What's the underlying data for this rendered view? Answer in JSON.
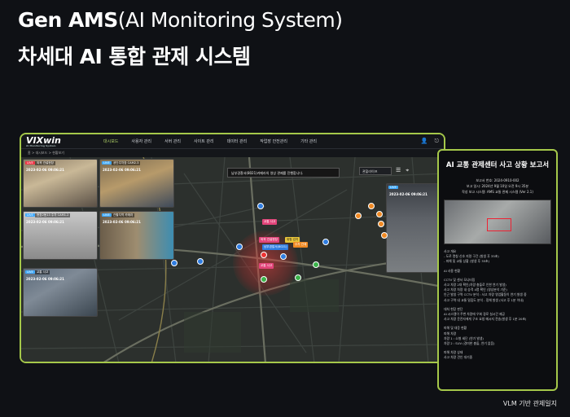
{
  "hero": {
    "title_bold": "Gen AMS",
    "title_thin": "(AI Monitoring System)",
    "subtitle": "차세대 AI 통합 관제 시스템"
  },
  "app": {
    "logo": "VIXwin",
    "logo_sub": "AI Monitoring System",
    "nav": [
      "대시보드",
      "사용자 관리",
      "서버 관리",
      "사이트 관리",
      "데이터 관리",
      "작업장 안전관리",
      "기타 관리"
    ],
    "nav_active_index": 0,
    "breadcrumb": "홈 > 대시보드 > 현황보기",
    "notice": "남부경찰서(8021)카메라의 영상 관제를 진행합니다.",
    "select_value": "관할라이프",
    "cameras": [
      {
        "tag": "LIVE",
        "name": "외곽 건설현장",
        "time": "2023-02-06 09:06:21"
      },
      {
        "tag": "LIVE",
        "name": "공단주차장 CAM2.3",
        "time": "2023-02-06 09:06:21"
      },
      {
        "tag": "LIVE",
        "name": "현장2동13 주차 CAM1.2",
        "time": "2023-02-06 09:06:21"
      },
      {
        "tag": "LIVE",
        "name": "관할지역 카메라",
        "time": "2023-02-06 09:06:21"
      },
      {
        "tag": "LIVE",
        "name": "교통 사고",
        "time": "2023-02-06 09:06:21"
      },
      {
        "tag": "LIVE",
        "name": "",
        "time": "2023-02-06 09:06:21"
      }
    ],
    "map_labels": {
      "a": "교통 사고",
      "b": "외곽 건설현장",
      "c": "남부경찰서(8021)",
      "d": "위험 감지",
      "e": "주차 관제",
      "f": "교통 사고"
    },
    "colors": {
      "accent": "#a5c84a",
      "live": "#3fa9ff"
    }
  },
  "report": {
    "title": "AI 교통 관제센터 사고 상황 보고서",
    "meta": [
      "보고서 번호: 2024-0910-002",
      "보고 일시: 2024년 9월 10일 오전 9시 35분",
      "작성 보고 시스템: AMS 교통 관제 시스템 (Ver 2.1)"
    ],
    "sections": [
      {
        "head": "사고 개요",
        "lines": [
          "- 도로 명칭 신호 지령 구간 (발생 후 35초)",
          "- 피해 및 교통 상황 (발생 후 35초)"
        ]
      },
      {
        "head": "AI 사용 현황",
        "lines": []
      },
      {
        "head": "CCTV 및 센서 모니터링",
        "lines": [
          "사고 차량 2대 확인(차량 충돌로 인한 연기 발생)",
          "사고 차량 차량 내 승객 4명 확인 (영상분석 기준)",
          "인근 발생 구역 CCTV 분석 : 사고 차량 영업활동이 연기 발생 중",
          "사고 구역 내 교통 밀집도 분석 - 정체 발생 (사고 후 1분 이내)"
        ]
      },
      {
        "head": "대처 현장 판단",
        "lines": [
          "AI 시스템이 주변 차량에 우회 경로 실시간 제공",
          "사고 차량 운전자에게 구조 요청 메시지 전송(발생 후 1분 20초)"
        ]
      },
      {
        "head": "피해 및 대응 현황",
        "lines": [
          "피해 차량",
          "차량 1 : 소형 세단 (연기 발생)",
          "차량 2 : SUV (경미한 충돌, 연기 없음)"
        ]
      },
      {
        "head": "피해 차량 상태",
        "lines": [
          "사고 차량 견인 대기중"
        ]
      }
    ]
  },
  "footer": "VLM 기반 관제일지"
}
